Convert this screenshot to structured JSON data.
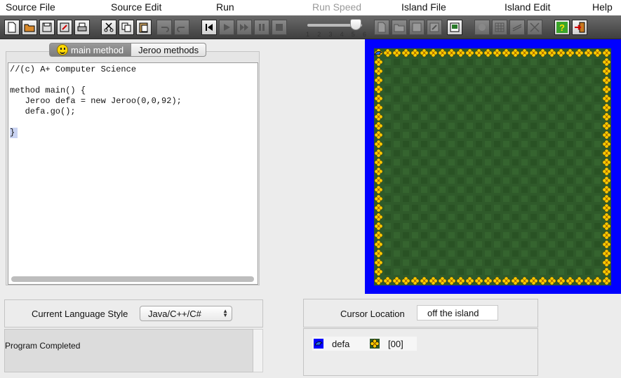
{
  "menubar": {
    "items": [
      {
        "label": "Source File",
        "enabled": true
      },
      {
        "label": "Source Edit",
        "enabled": true
      },
      {
        "label": "Run",
        "enabled": true
      },
      {
        "label": "Run Speed",
        "enabled": false
      },
      {
        "label": "Island File",
        "enabled": true
      },
      {
        "label": "Island Edit",
        "enabled": true
      },
      {
        "label": "Help",
        "enabled": true
      }
    ]
  },
  "toolbar": {
    "run_speed": {
      "tick_labels": [
        "1",
        "2",
        "3",
        "4",
        "5",
        "6"
      ],
      "selected": 6
    }
  },
  "editor": {
    "tabs": [
      {
        "label": "main method",
        "active": true
      },
      {
        "label": "Jeroo methods",
        "active": false
      }
    ],
    "code_lines": [
      "//(c) A+ Computer Science",
      "",
      "method main() {",
      "   Jeroo defa = new Jeroo(0,0,92);",
      "   defa.go();",
      "",
      "}"
    ],
    "highlighted_line": 7
  },
  "island": {
    "colors": {
      "water": "#0000ff",
      "grass": "#2f5a2a",
      "flower": "#ffcc00"
    }
  },
  "language": {
    "label": "Current Language Style",
    "selected": "Java/C++/C#"
  },
  "messages": {
    "text": "Program Completed"
  },
  "cursor": {
    "label": "Cursor Location",
    "value": "off the island"
  },
  "jeroo_status": {
    "name": "defa",
    "flowers": "[00]"
  }
}
